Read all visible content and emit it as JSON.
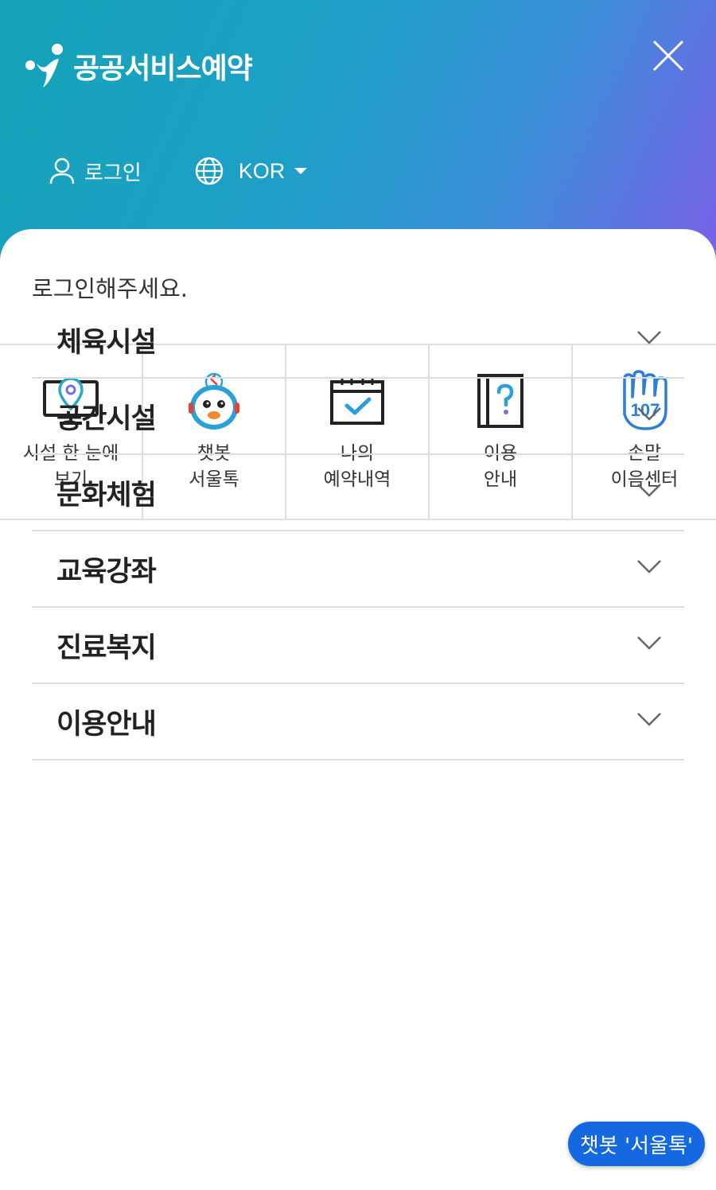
{
  "header": {
    "logo_text": "공공서비스예약",
    "login_label": "로그인",
    "language_label": "KOR"
  },
  "panel": {
    "greeting": "로그인해주세요."
  },
  "quick_menu": [
    {
      "line1": "시설 한 눈에",
      "line2": "보기",
      "icon": "facility-map-icon"
    },
    {
      "line1": "챗봇",
      "line2": "서울톡",
      "icon": "chatbot-mascot-icon"
    },
    {
      "line1": "나의",
      "line2": "예약내역",
      "icon": "calendar-check-icon"
    },
    {
      "line1": "이용",
      "line2": "안내",
      "icon": "question-book-icon"
    },
    {
      "line1": "손말",
      "line2": "이음센터",
      "icon": "sign-language-107-icon"
    }
  ],
  "menu": [
    {
      "label": "체육시설"
    },
    {
      "label": "공간시설"
    },
    {
      "label": "문화체험"
    },
    {
      "label": "교육강좌"
    },
    {
      "label": "진료복지"
    },
    {
      "label": "이용안내"
    }
  ],
  "chatbot_button": "챗봇 '서울톡'",
  "colors": {
    "header_gradient_start": "#14a3b8",
    "header_gradient_end": "#7a5fe8",
    "accent_blue": "#1469e0",
    "divider": "#dcdcdc"
  }
}
